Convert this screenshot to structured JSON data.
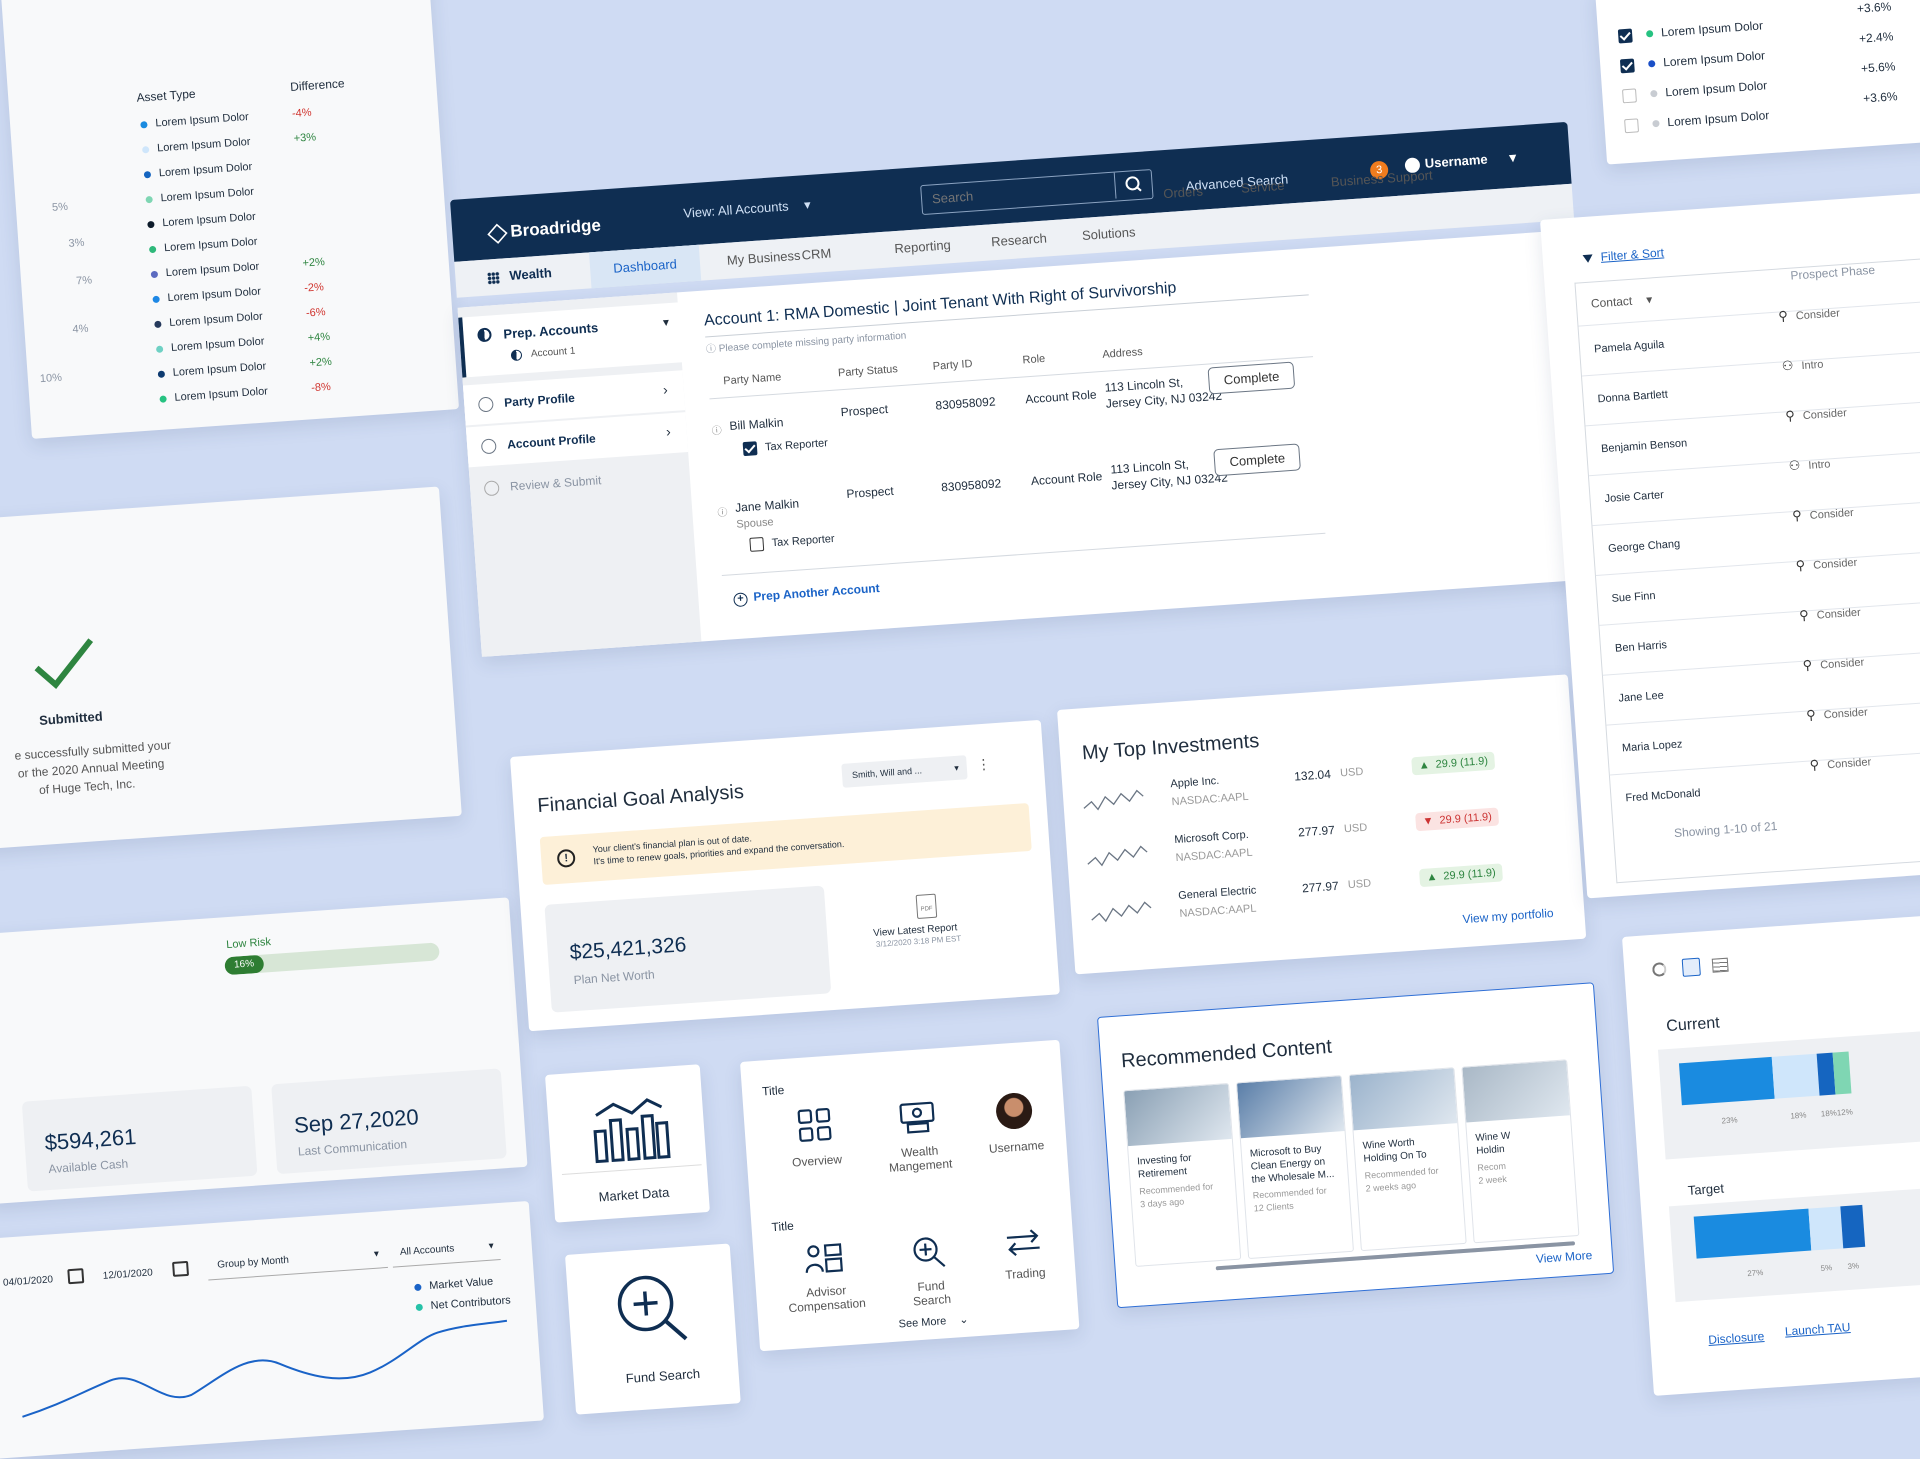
{
  "asset_card": {
    "col_asset": "Asset Type",
    "col_diff": "Difference",
    "rows": [
      {
        "label": "Lorem Ipsum Dolor",
        "diff": "-4%",
        "color": "#1a8be0"
      },
      {
        "label": "Lorem Ipsum Dolor",
        "diff": "+3%",
        "color": "#cfe6fb"
      },
      {
        "label": "Lorem Ipsum Dolor",
        "diff": "",
        "color": "#1565c0"
      },
      {
        "label": "Lorem Ipsum Dolor",
        "diff": "",
        "color": "#7fd6b3"
      },
      {
        "label": "Lorem Ipsum Dolor",
        "diff": "",
        "color": "#0d1b2a"
      },
      {
        "label": "Lorem Ipsum Dolor",
        "diff": "",
        "color": "#2eb87a"
      },
      {
        "label": "Lorem Ipsum Dolor",
        "diff": "+2%",
        "color": "#5c6bc0"
      },
      {
        "label": "Lorem Ipsum Dolor",
        "diff": "-2%",
        "color": "#1e88e5"
      },
      {
        "label": "Lorem Ipsum Dolor",
        "diff": "-6%",
        "color": "#263a5c"
      },
      {
        "label": "Lorem Ipsum Dolor",
        "diff": "+4%",
        "color": "#6fd1c4"
      },
      {
        "label": "Lorem Ipsum Dolor",
        "diff": "+2%",
        "color": "#0e3b70"
      },
      {
        "label": "Lorem Ipsum Dolor",
        "diff": "-8%",
        "color": "#26c281"
      }
    ],
    "pie_labels": [
      "5%",
      "3%",
      "7%",
      "4%",
      "10%"
    ]
  },
  "submitted_card": {
    "title": "Submitted",
    "line1": "e successfully submitted your",
    "line2": "or the 2020 Annual Meeting",
    "line3": "of Huge Tech, Inc."
  },
  "risk_card": {
    "risk_label": "Low Risk",
    "risk_pct": "16%",
    "risk_fill": 0.16,
    "cash_value": "$594,261",
    "cash_label": "Available Cash",
    "comm_value": "Sep 27,2020",
    "comm_label": "Last Communication"
  },
  "timeline_card": {
    "date_from": "04/01/2020",
    "date_to": "12/01/2020",
    "group_by": "Group by Month",
    "accounts": "All Accounts",
    "legend": [
      {
        "label": "Market Value",
        "color": "#1a63c7"
      },
      {
        "label": "Net Contributors",
        "color": "#26c2a8"
      }
    ]
  },
  "header": {
    "brand": "Broadridge",
    "view": "View: All Accounts",
    "search_placeholder": "Search",
    "advanced_search": "Advanced Search",
    "notif_count": "3",
    "username": "Username",
    "nav": [
      "CRM",
      "Reporting",
      "Research",
      "Solutions",
      "Orders",
      "Service",
      "Business Support"
    ],
    "app_name": "Wealth",
    "tabs": [
      "Dashboard",
      "My Business"
    ]
  },
  "prep": {
    "title": "Prep. Accounts",
    "sub": "Account 1",
    "steps": [
      "Party Profile",
      "Account Profile",
      "Review & Submit"
    ],
    "account_title": "Account 1: RMA Domestic | Joint Tenant With Right of Survivorship",
    "account_note": "Please complete missing party information",
    "cols": [
      "Party Name",
      "Party Status",
      "Party ID",
      "Role",
      "Address"
    ],
    "parties": [
      {
        "name": "Bill Malkin",
        "sub": "",
        "status": "Prospect",
        "id": "830958092",
        "role": "Account Role",
        "addr1": "113 Lincoln St,",
        "addr2": "Jersey City, NJ 03242",
        "tax": "Tax Reporter",
        "tax_checked": true,
        "action": "Complete"
      },
      {
        "name": "Jane Malkin",
        "sub": "Spouse",
        "status": "Prospect",
        "id": "830958092",
        "role": "Account Role",
        "addr1": "113 Lincoln St,",
        "addr2": "Jersey City, NJ 03242",
        "tax": "Tax Reporter",
        "tax_checked": false,
        "action": "Complete"
      }
    ],
    "prep_another": "Prep Another Account"
  },
  "goal": {
    "title": "Financial Goal Analysis",
    "client": "Smith, Will and ...",
    "warn1": "Your client's financial plan is out of date.",
    "warn2": "It's time to renew goals, priorities and expand the conversation.",
    "value": "$25,421,326",
    "value_label": "Plan Net Worth",
    "report_label": "View Latest Report",
    "report_date": "3/12/2020 3:18 PM EST"
  },
  "investments": {
    "title": "My Top Investments",
    "rows": [
      {
        "name": "Apple Inc.",
        "ticker": "NASDAC:AAPL",
        "price": "132.04",
        "cur": "USD",
        "change": "29.9 (11.9)",
        "up": true
      },
      {
        "name": "Microsoft Corp.",
        "ticker": "NASDAC:AAPL",
        "price": "277.97",
        "cur": "USD",
        "change": "29.9 (11.9)",
        "up": false
      },
      {
        "name": "General Electric",
        "ticker": "NASDAC:AAPL",
        "price": "277.97",
        "cur": "USD",
        "change": "29.9 (11.9)",
        "up": true
      }
    ],
    "link": "View my portfolio"
  },
  "top_right": {
    "rows": [
      {
        "label": "Lorem Ipsum Dolor",
        "val": "+3.6%",
        "checked": true,
        "color": "#26c281"
      },
      {
        "label": "Lorem Ipsum Dolor",
        "val": "+2.4%",
        "checked": true,
        "color": "#1a4fc7"
      },
      {
        "label": "Lorem Ipsum Dolor",
        "val": "+5.6%",
        "checked": false,
        "color": "#c8ccd2"
      },
      {
        "label": "Lorem Ipsum Dolor",
        "val": "+3.6%",
        "checked": false,
        "color": "#c8ccd2"
      }
    ]
  },
  "contacts": {
    "filter": "Filter & Sort",
    "col_contact": "Contact",
    "col_phase": "Prospect Phase",
    "rows": [
      {
        "name": "Pamela Aguila",
        "phase": "Consider"
      },
      {
        "name": "Donna Bartlett",
        "phase": "Intro"
      },
      {
        "name": "Benjamin Benson",
        "phase": "Consider"
      },
      {
        "name": "Josie Carter",
        "phase": "Intro"
      },
      {
        "name": "George Chang",
        "phase": "Consider"
      },
      {
        "name": "Sue Finn",
        "phase": "Consider"
      },
      {
        "name": "Ben Harris",
        "phase": "Consider"
      },
      {
        "name": "Jane Lee",
        "phase": "Consider"
      },
      {
        "name": "Maria Lopez",
        "phase": "Consider"
      },
      {
        "name": "Fred McDonald",
        "phase": "Consider"
      }
    ],
    "footer": "Showing 1-10 of 21"
  },
  "allocation": {
    "current_label": "Current",
    "target_label": "Target",
    "current": [
      {
        "pct": "23%",
        "color": "#1a8be0",
        "w": 0.58
      },
      {
        "pct": "18%",
        "color": "#cfe6fb",
        "w": 0.28
      },
      {
        "pct": "18%",
        "color": "#1565c0",
        "w": 0.1
      },
      {
        "pct": "12%",
        "color": "#7fd6b3",
        "w": 0.1
      }
    ],
    "target": [
      {
        "pct": "27%",
        "color": "#1a8be0",
        "w": 0.72
      },
      {
        "pct": "5%",
        "color": "#cfe6fb",
        "w": 0.2
      },
      {
        "pct": "3%",
        "color": "#1565c0",
        "w": 0.14
      }
    ],
    "disclosure": "Disclosure",
    "launch": "Launch TAU"
  },
  "market": {
    "label": "Market Data"
  },
  "fund": {
    "label": "Fund Search"
  },
  "tools": {
    "title1": "Title",
    "row1": [
      {
        "label": "Overview",
        "label2": ""
      },
      {
        "label": "Wealth",
        "label2": "Mangement"
      },
      {
        "label": "Username",
        "label2": ""
      }
    ],
    "title2": "Title",
    "row2": [
      {
        "label": "Advisor",
        "label2": "Compensation"
      },
      {
        "label": "Fund",
        "label2": "Search"
      },
      {
        "label": "Trading",
        "label2": ""
      }
    ],
    "see_more": "See More"
  },
  "recommended": {
    "title": "Recommended Content",
    "items": [
      {
        "t1": "Investing for",
        "t2": "Retirement",
        "t3": "",
        "m1": "Recommended for",
        "m2": "3 days ago"
      },
      {
        "t1": "Microsoft to Buy",
        "t2": "Clean Energy on",
        "t3": "the Wholesale M...",
        "m1": "Recommended for",
        "m2": "12 Clients"
      },
      {
        "t1": "Wine Worth",
        "t2": "Holding On To",
        "t3": "",
        "m1": "Recommended for",
        "m2": "2 weeks ago"
      },
      {
        "t1": "Wine W",
        "t2": "Holdin",
        "t3": "",
        "m1": "Recom",
        "m2": "2 week"
      }
    ],
    "view_more": "View More"
  }
}
